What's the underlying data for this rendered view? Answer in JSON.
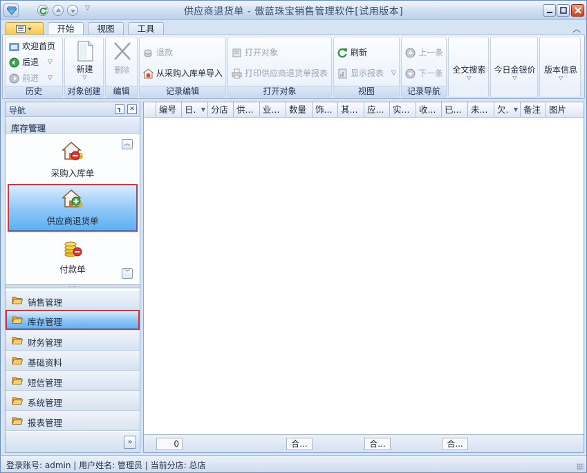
{
  "window": {
    "title": "供应商退货单 - 傲蓝珠宝销售管理软件[试用版本]"
  },
  "ribbon": {
    "tabs": [
      {
        "label": "开始",
        "active": true
      },
      {
        "label": "视图",
        "active": false
      },
      {
        "label": "工具",
        "active": false
      }
    ],
    "history": {
      "welcome": "欢迎首页",
      "back": "后退",
      "forward": "前进",
      "label": "历史"
    },
    "create": {
      "new": "新建",
      "label": "对象创建"
    },
    "edit": {
      "delete": "删除",
      "label": "编辑"
    },
    "record_edit": {
      "refund": "退款",
      "import": "从采购入库单导入",
      "label": "记录编辑"
    },
    "open": {
      "open_object": "打开对象",
      "print_report": "打印供应商退货单报表",
      "label": "打开对象"
    },
    "view": {
      "refresh": "刷新",
      "show_report": "显示报表",
      "label": "视图"
    },
    "nav": {
      "prev": "上一条",
      "next": "下一条",
      "label": "记录导航"
    },
    "fulltext": "全文搜索",
    "gold_price": "今日金银价",
    "version": "版本信息"
  },
  "navpane": {
    "title": "导航",
    "section": "库存管理",
    "items": [
      {
        "label": "采购入库单",
        "selected": false
      },
      {
        "label": "供应商退货单",
        "selected": true
      },
      {
        "label": "付款单",
        "selected": false
      }
    ],
    "groups": [
      {
        "label": "销售管理",
        "selected": false
      },
      {
        "label": "库存管理",
        "selected": true
      },
      {
        "label": "财务管理",
        "selected": false
      },
      {
        "label": "基础资料",
        "selected": false
      },
      {
        "label": "短信管理",
        "selected": false
      },
      {
        "label": "系统管理",
        "selected": false
      },
      {
        "label": "报表管理",
        "selected": false
      }
    ]
  },
  "grid": {
    "columns": [
      "编号",
      "日.",
      "分店",
      "供...",
      "业...",
      "数量",
      "饰...",
      "其...",
      "应...",
      "实...",
      "收...",
      "已...",
      "未...",
      "欠.",
      "备注",
      "图片"
    ],
    "footer": {
      "count": "0",
      "sum1": "合...",
      "sum2": "合...",
      "sum3": "合..."
    }
  },
  "statusbar": {
    "text": "登录账号: admin  |  用户姓名: 管理员  |  当前分店: 总店"
  },
  "colors": {
    "accent": "#5eb0f4",
    "highlight_border": "#e0303a",
    "refresh_green": "#2f9a3a"
  }
}
